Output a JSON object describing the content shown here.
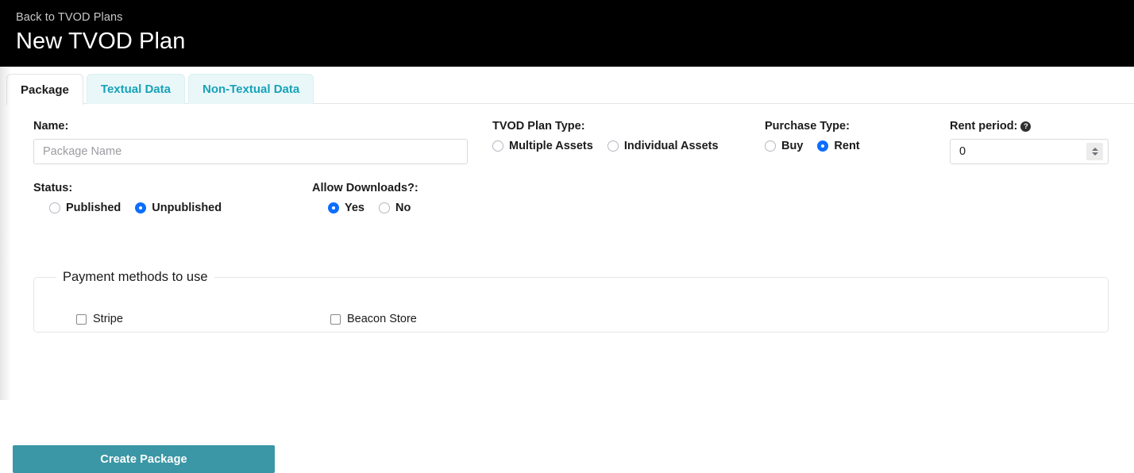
{
  "header": {
    "back_link": "Back to TVOD Plans",
    "title": "New TVOD Plan"
  },
  "tabs": [
    {
      "label": "Package",
      "active": true
    },
    {
      "label": "Textual Data",
      "active": false
    },
    {
      "label": "Non-Textual Data",
      "active": false
    }
  ],
  "form": {
    "name": {
      "label": "Name:",
      "value": "",
      "placeholder": "Package Name"
    },
    "plan_type": {
      "label": "TVOD Plan Type:",
      "options": [
        {
          "label": "Multiple Assets",
          "selected": false
        },
        {
          "label": "Individual Assets",
          "selected": false
        }
      ]
    },
    "purchase_type": {
      "label": "Purchase Type:",
      "options": [
        {
          "label": "Buy",
          "selected": false
        },
        {
          "label": "Rent",
          "selected": true
        }
      ]
    },
    "rent_period": {
      "label": "Rent period:",
      "help_icon": "question-mark-circle-icon",
      "value": "0"
    },
    "status": {
      "label": "Status:",
      "options": [
        {
          "label": "Published",
          "selected": false
        },
        {
          "label": "Unpublished",
          "selected": true
        }
      ]
    },
    "allow_downloads": {
      "label": "Allow Downloads?:",
      "options": [
        {
          "label": "Yes",
          "selected": true
        },
        {
          "label": "No",
          "selected": false
        }
      ]
    },
    "payment_methods": {
      "legend": "Payment methods to use",
      "options": [
        {
          "label": "Stripe",
          "checked": false
        },
        {
          "label": "Beacon Store",
          "checked": false
        }
      ]
    },
    "submit_label": "Create Package"
  },
  "colors": {
    "header_bg": "#000000",
    "tab_active_text": "#1b1b1b",
    "tab_inactive_text": "#17a2b8",
    "tab_inactive_bg": "#e9f7f9",
    "radio_selected": "#0d6efd",
    "submit_bg": "#3b97a5"
  }
}
